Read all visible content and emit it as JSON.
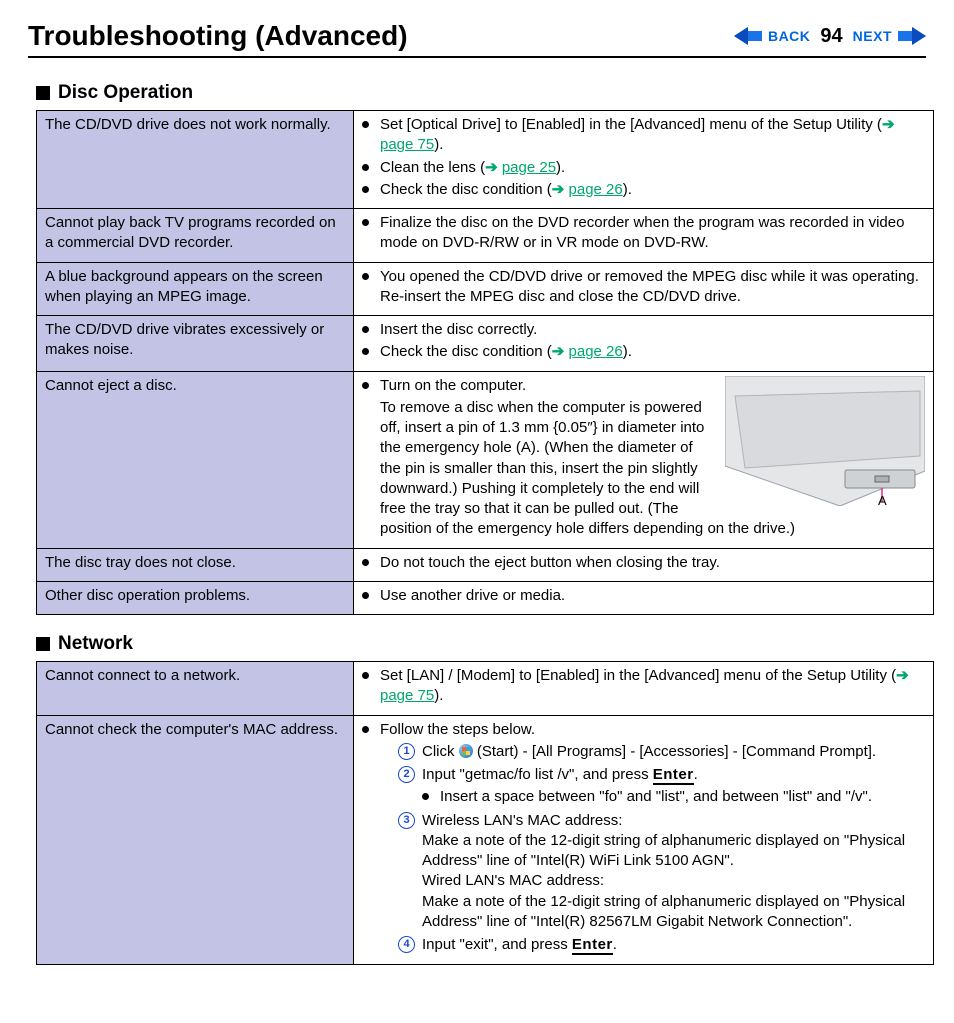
{
  "header": {
    "title": "Troubleshooting (Advanced)",
    "back": "BACK",
    "page": "94",
    "next": "NEXT"
  },
  "sections": {
    "disc": "Disc Operation",
    "network": "Network"
  },
  "disc_rows": {
    "r0": {
      "problem": "The CD/DVD drive does not work normally.",
      "s1a": "Set [Optical Drive] to [Enabled] in the [Advanced] menu of the Setup Utility (",
      "s1link": "page 75",
      "s1b": ").",
      "s2a": "Clean the lens (",
      "s2link": "page 25",
      "s2b": ").",
      "s3a": "Check the disc condition (",
      "s3link": "page 26",
      "s3b": ")."
    },
    "r1": {
      "problem": "Cannot play back TV programs recorded on a commercial DVD recorder.",
      "s1": "Finalize the disc on the DVD recorder when the program was recorded in video mode on DVD-R/RW or in VR mode on DVD-RW."
    },
    "r2": {
      "problem": "A blue background appears on the screen when playing an MPEG image.",
      "s1": "You opened the CD/DVD drive or removed the MPEG disc while it was operating. Re-insert the MPEG disc and close the CD/DVD drive."
    },
    "r3": {
      "problem": "The CD/DVD drive vibrates excessively or makes noise.",
      "s1": "Insert the disc correctly.",
      "s2a": "Check the disc condition (",
      "s2link": "page 26",
      "s2b": ")."
    },
    "r4": {
      "problem": "Cannot eject a disc.",
      "s1": "Turn on the computer.",
      "s1cont": "To remove a disc when the computer is powered off, insert a pin of 1.3 mm {0.05″} in diameter into the emergency hole (A). (When the diameter of the pin is smaller than this, insert the pin slightly downward.) Pushing it completely to the end will free the tray so that it can be pulled out. (The position of the emergency hole differs depending on the drive.)",
      "figlabel": "A"
    },
    "r5": {
      "problem": "The disc tray does not close.",
      "s1": "Do not touch the eject button when closing the tray."
    },
    "r6": {
      "problem": "Other disc operation problems.",
      "s1": "Use another drive or media."
    }
  },
  "net_rows": {
    "r0": {
      "problem": "Cannot connect to a network.",
      "s1a": "Set [LAN] / [Modem] to [Enabled] in the [Advanced] menu of the Setup Utility (",
      "s1link": "page 75",
      "s1b": ")."
    },
    "r1": {
      "problem": "Cannot check the computer's MAC address.",
      "s1": "Follow the steps below.",
      "step1": "Click  (Start) - [All Programs] - [Accessories] - [Command Prompt].",
      "step2a": "Input \"getmac/fo list /v\", and press ",
      "enter": "Enter",
      "step2b": ".",
      "step2note": "Insert a space between \"fo\" and \"list\", and between \"list\" and \"/v\".",
      "step3a": "Wireless LAN's MAC address:",
      "step3b": "Make a note of the 12-digit string of alphanumeric displayed on \"Physical Address\" line of \"Intel(R) WiFi Link 5100 AGN\".",
      "step3c": "Wired LAN's MAC address:",
      "step3d": "Make a note of the 12-digit string of alphanumeric displayed on \"Physical Address\" line of \"Intel(R) 82567LM Gigabit Network Connection\".",
      "step4a": "Input \"exit\", and press ",
      "step4b": "."
    }
  }
}
